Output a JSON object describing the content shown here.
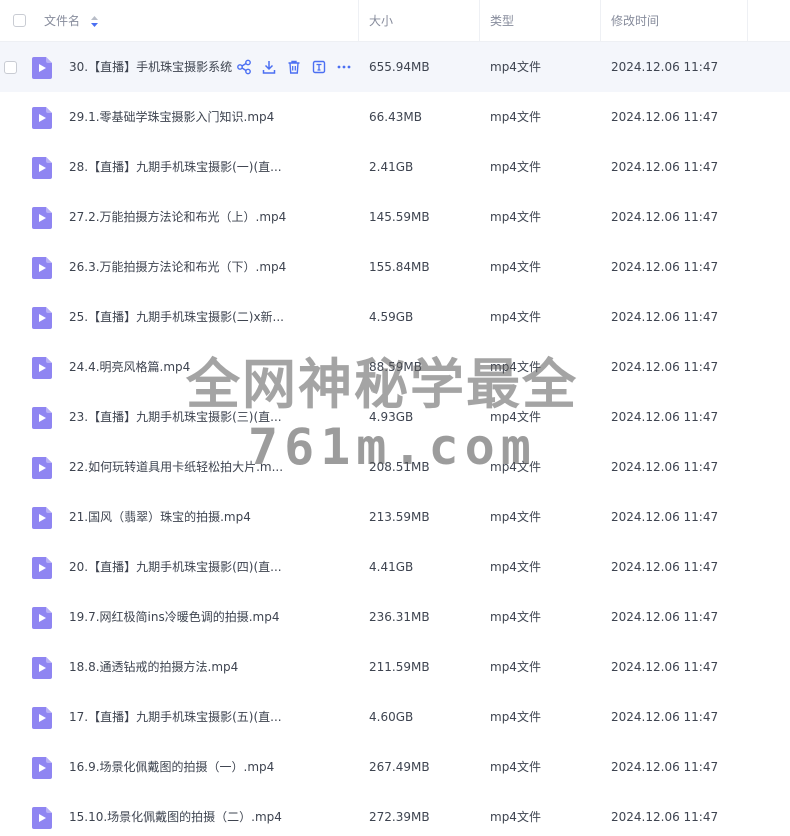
{
  "header": {
    "name_label": "文件名",
    "size_label": "大小",
    "type_label": "类型",
    "time_label": "修改时间"
  },
  "icons": {
    "sort": "sort-icon",
    "file": "video-file-icon",
    "share": "share-icon",
    "download": "download-icon",
    "delete": "trash-icon",
    "rename": "rename-icon",
    "more": "more-icon"
  },
  "colors": {
    "file_icon": "#8f85f2",
    "action_icon": "#4b6ff2",
    "hover_row": "#f4f6fb"
  },
  "rows": [
    {
      "name": "30.【直播】手机珠宝摄影系统",
      "size": "655.94MB",
      "type": "mp4文件",
      "time": "2024.12.06 11:47"
    },
    {
      "name": "29.1.零基础学珠宝摄影入门知识.mp4",
      "size": "66.43MB",
      "type": "mp4文件",
      "time": "2024.12.06 11:47"
    },
    {
      "name": "28.【直播】九期手机珠宝摄影(一)(直...",
      "size": "2.41GB",
      "type": "mp4文件",
      "time": "2024.12.06 11:47"
    },
    {
      "name": "27.2.万能拍摄方法论和布光（上）.mp4",
      "size": "145.59MB",
      "type": "mp4文件",
      "time": "2024.12.06 11:47"
    },
    {
      "name": "26.3.万能拍摄方法论和布光（下）.mp4",
      "size": "155.84MB",
      "type": "mp4文件",
      "time": "2024.12.06 11:47"
    },
    {
      "name": "25.【直播】九期手机珠宝摄影(二)x新...",
      "size": "4.59GB",
      "type": "mp4文件",
      "time": "2024.12.06 11:47"
    },
    {
      "name": "24.4.明亮风格篇.mp4",
      "size": "88.59MB",
      "type": "mp4文件",
      "time": "2024.12.06 11:47"
    },
    {
      "name": "23.【直播】九期手机珠宝摄影(三)(直...",
      "size": "4.93GB",
      "type": "mp4文件",
      "time": "2024.12.06 11:47"
    },
    {
      "name": "22.如何玩转道具用卡纸轻松拍大片.m...",
      "size": "208.51MB",
      "type": "mp4文件",
      "time": "2024.12.06 11:47"
    },
    {
      "name": "21.国风（翡翠）珠宝的拍摄.mp4",
      "size": "213.59MB",
      "type": "mp4文件",
      "time": "2024.12.06 11:47"
    },
    {
      "name": "20.【直播】九期手机珠宝摄影(四)(直...",
      "size": "4.41GB",
      "type": "mp4文件",
      "time": "2024.12.06 11:47"
    },
    {
      "name": "19.7.网红极简ins冷暖色调的拍摄.mp4",
      "size": "236.31MB",
      "type": "mp4文件",
      "time": "2024.12.06 11:47"
    },
    {
      "name": "18.8.通透钻戒的拍摄方法.mp4",
      "size": "211.59MB",
      "type": "mp4文件",
      "time": "2024.12.06 11:47"
    },
    {
      "name": "17.【直播】九期手机珠宝摄影(五)(直...",
      "size": "4.60GB",
      "type": "mp4文件",
      "time": "2024.12.06 11:47"
    },
    {
      "name": "16.9.场景化佩戴图的拍摄（一）.mp4",
      "size": "267.49MB",
      "type": "mp4文件",
      "time": "2024.12.06 11:47"
    },
    {
      "name": "15.10.场景化佩戴图的拍摄（二）.mp4",
      "size": "272.39MB",
      "type": "mp4文件",
      "time": "2024.12.06 11:47"
    }
  ],
  "watermark": {
    "line1": "全网神秘学最全",
    "line2": "761m.com"
  }
}
